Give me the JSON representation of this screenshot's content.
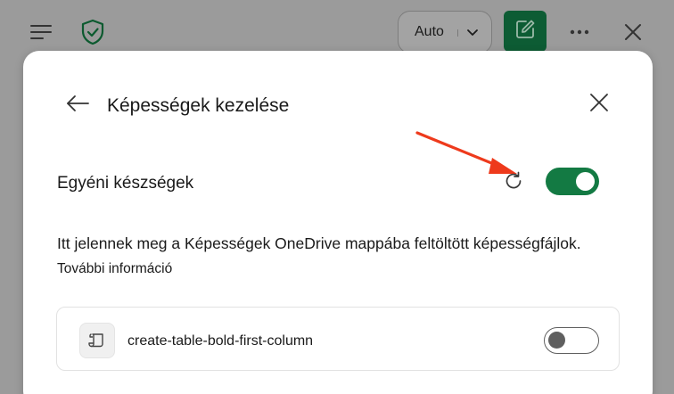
{
  "toolbar": {
    "menu_icon": "hamburger-menu-icon",
    "shield_icon": "shield-check-icon",
    "mode_select": {
      "value": "Auto",
      "icon": "chevron-down-icon"
    },
    "compose_icon": "compose-icon",
    "more_icon": "more-horizontal-icon",
    "close_icon": "close-icon"
  },
  "dialog": {
    "title": "Képességek kezelése",
    "back_icon": "arrow-left-icon",
    "close_icon": "close-icon",
    "section": {
      "title": "Egyéni készségek",
      "refresh_icon": "refresh-icon",
      "enabled": true
    },
    "description": "Itt jelennek meg a Képességek OneDrive mappába feltöltött képességfájlok.",
    "more_info_link": "További információ",
    "skills": [
      {
        "name": "create-table-bold-first-column",
        "icon": "script-file-icon",
        "enabled": false
      }
    ]
  },
  "colors": {
    "accent_green": "#137a43",
    "compose_bg": "#0d5c34",
    "annotation_arrow": "#ee3a1c",
    "overlay": "#9b9b9b"
  }
}
